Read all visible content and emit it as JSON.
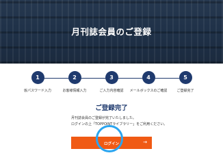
{
  "header": {
    "title": "月刊誌会員のご登録"
  },
  "steps": [
    {
      "number": "1",
      "label": "仮パスワード入力"
    },
    {
      "number": "2",
      "label": "お客様情報入力"
    },
    {
      "number": "3",
      "label": "ご入力内容確認"
    },
    {
      "number": "4",
      "label": "メールボックスのご確認"
    },
    {
      "number": "5",
      "label": "ご登録完了"
    }
  ],
  "main": {
    "title": "ご登録完了",
    "message_line1": "月刊誌会員のご登録が完了いたしました。",
    "message_line2": "ログインの上「TOPPOINTライブラリー」をご利用ください。",
    "login_label": "ログイン",
    "login_arrow": "→"
  },
  "colors": {
    "accent": "#1f3a6e",
    "button": "#f05a14",
    "highlight": "#2aa5f0"
  },
  "icons": {
    "button_arrow": "arrow-right-icon"
  }
}
